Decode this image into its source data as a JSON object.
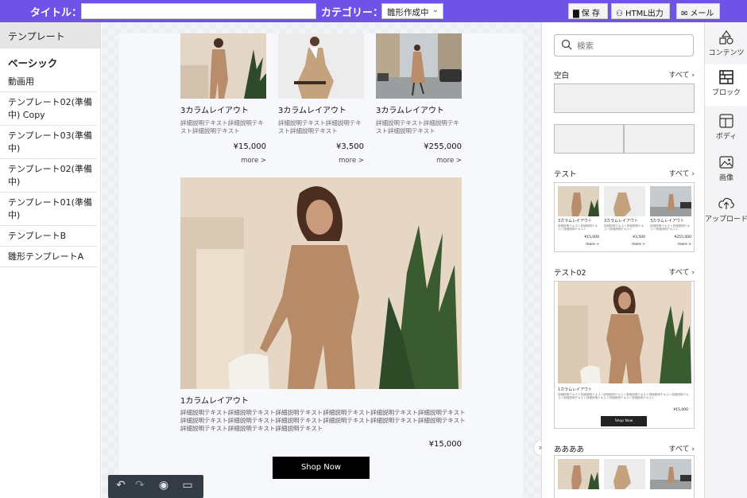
{
  "topbar": {
    "title_label": "タイトル：",
    "title_value": "",
    "category_label": "カテゴリー：",
    "category_value": "雛形作成中",
    "save_label": "保 存",
    "html_label": "HTML出力",
    "mail_label": "メール"
  },
  "left": {
    "header": "テンプレート",
    "subheader": "ベーシック",
    "items": [
      "動画用",
      "テンプレート02(準備中) Copy",
      "テンプレート03(準備中)",
      "テンプレート02(準備中)",
      "テンプレート01(準備中)",
      "テンプレートB",
      "雛形テンプレートA"
    ]
  },
  "canvas": {
    "products": [
      {
        "title": "3カラムレイアウト",
        "desc": "詳細説明テキスト詳細説明テキスト詳細説明テキスト",
        "price": "¥15,000",
        "more": "more >"
      },
      {
        "title": "3カラムレイアウト",
        "desc": "詳細説明テキスト詳細説明テキスト詳細説明テキスト",
        "price": "¥3,500",
        "more": "more >"
      },
      {
        "title": "3カラムレイアウト",
        "desc": "詳細説明テキスト詳細説明テキスト詳細説明テキスト",
        "price": "¥255,000",
        "more": "more >"
      }
    ],
    "one_column": {
      "title": "1カラムレイアウト",
      "desc": "詳細説明テキスト詳細説明テキスト詳細説明テキスト詳細説明テキスト詳細説明テキスト詳細説明テキスト詳細説明テキスト詳細説明テキスト詳細説明テキスト詳細説明テキスト詳細説明テキスト詳細説明テキスト詳細説明テキスト詳細説明テキスト詳細説明テキスト",
      "price": "¥15,000",
      "button": "Shop Now"
    }
  },
  "right": {
    "search_placeholder": "検索",
    "sections": [
      {
        "title": "空白",
        "all": "すべて ›"
      },
      {
        "title": "テスト",
        "all": "すべて ›"
      },
      {
        "title": "テスト02",
        "all": "すべて ›"
      },
      {
        "title": "ああああ",
        "all": "すべて ›"
      }
    ],
    "mini": {
      "three_title": "3カラムレイアウト",
      "three_desc": "詳細説明テキスト詳細説明テキスト詳細説明テキスト",
      "prices": [
        "¥15,000",
        "¥3,500",
        "¥255,000"
      ],
      "more": "more >",
      "one_title": "1カラムレイアウト",
      "one_desc": "詳細説明テキスト詳細説明テキスト詳細説明テキスト詳細説明テキスト詳細説明テキスト詳細説明テキスト詳細説明テキスト詳細説明テキスト詳細説明テキスト詳細説明テキスト",
      "one_price": "¥15,000",
      "one_button": "Shop Now"
    }
  },
  "rail": {
    "items": [
      "コンテンツ",
      "ブロック",
      "ボディ",
      "画像",
      "アップロード"
    ],
    "active": "ブロック"
  },
  "colors": {
    "accent": "#6f53e7",
    "button": "#000000"
  }
}
